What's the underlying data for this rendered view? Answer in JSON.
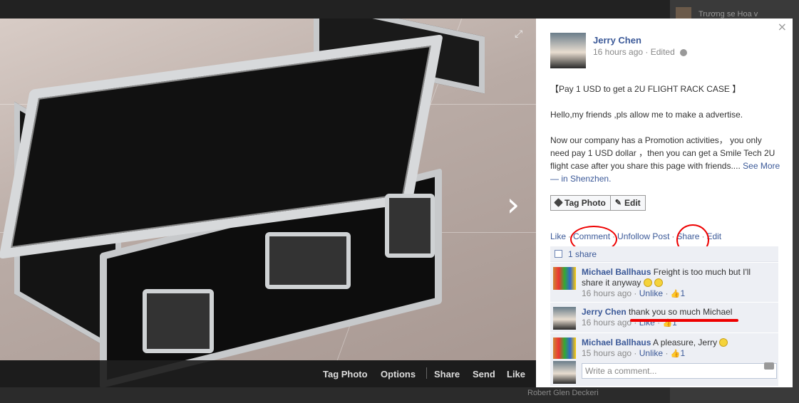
{
  "background": {
    "friend_name": "Trương se Hoa v",
    "bottom_name": "Robert Glen Deckeri"
  },
  "photo_bar": {
    "tag_photo": "Tag Photo",
    "options": "Options",
    "share": "Share",
    "send": "Send",
    "like": "Like"
  },
  "panel": {
    "close": "×",
    "author": "Jerry Chen",
    "time": "16 hours ago",
    "edited": "Edited",
    "post": {
      "title": "【Pay 1 USD to get a 2U FLIGHT RACK CASE 】",
      "line1": "Hello,my friends ,pls allow me to make a advertise.",
      "line2": "Now our company has a Promotion activities， you only need pay 1 USD dollar ，then you can get a Smile Tech 2U flight case after you share this page with friends....",
      "see_more": "See More",
      "dash": "—",
      "in": "in",
      "location": "Shenzhen",
      "period": "."
    },
    "buttons": {
      "tag_photo": "Tag Photo",
      "edit": "Edit"
    },
    "actions": {
      "like": "Like",
      "comment": "Comment",
      "unfollow": "Unfollow Post",
      "share": "Share",
      "edit": "Edit",
      "dot": "·"
    },
    "shares": "1 share",
    "comments": [
      {
        "name": "Michael Ballhaus",
        "text": "Freight is too much but I'll share it anyway",
        "time": "16 hours ago",
        "action": "Unlike",
        "likes": "1"
      },
      {
        "name": "Jerry Chen",
        "text": "thank you so much Michael",
        "time": "16 hours ago",
        "action": "Like",
        "likes": "1"
      },
      {
        "name": "Michael Ballhaus",
        "text": "A pleasure, Jerry",
        "time": "15 hours ago",
        "action": "Unlike",
        "likes": "1"
      }
    ],
    "write_placeholder": "Write a comment..."
  },
  "colors": {
    "link": "#3b5998",
    "annotation": "#e00000"
  }
}
